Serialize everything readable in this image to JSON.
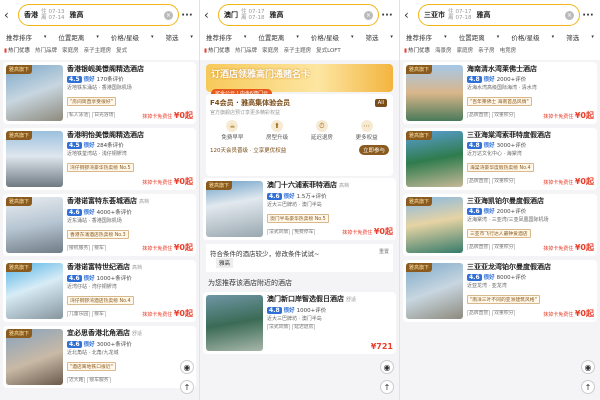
{
  "screens": [
    {
      "city": "香港",
      "checkin": "07-13",
      "checkout": "07-14",
      "checkin_label": "住",
      "checkout_label": "离",
      "keyword": "雅高",
      "filters": [
        "推荐排序",
        "位置距离",
        "价格/星级",
        "筛选"
      ],
      "chips": [
        "热门优惠",
        "热门品牌",
        "家庭房",
        "亲子主题房",
        "复式"
      ],
      "hotels": [
        {
          "name": "香港银岘美憬阁精选酒店",
          "sub": "",
          "badge": "雅高旗下",
          "score": "4.5",
          "level": "很好",
          "reviews": "170条评价",
          "loc": "近地铁东涌站 · 香港国际机场",
          "tag": "\"房间简直享受很好\"",
          "extra": [
            "私人泳池",
            "日光浴场"
          ],
          "price": "¥0起",
          "price_note": "抹掉卡免费住"
        },
        {
          "name": "香港明怡美憬阁精选酒店",
          "sub": "",
          "badge": "雅高旗下",
          "score": "4.5",
          "level": "很好",
          "reviews": "284条评价",
          "loc": "近地铁荃湾站 · 浅仔铜锣湾",
          "tag": "湾仔铜锣湾豪华热卖榜 No.5",
          "extra": [],
          "price": "¥0起",
          "price_note": "抹掉卡免费住"
        },
        {
          "name": "香港诺富特东荟城酒店",
          "sub": "高档",
          "badge": "雅高旗下",
          "score": "4.6",
          "level": "很好",
          "reviews": "4000+条评价",
          "loc": "近东涌站 · 香港国际机场",
          "tag": "香港东涌酒店热卖榜 No.3",
          "extra": [
            "接机服务",
            "接车"
          ],
          "price": "¥0起",
          "price_note": "抹掉卡免费住"
        },
        {
          "name": "香港诺富特世纪酒店",
          "sub": "高档",
          "badge": "雅高旗下",
          "score": "4.6",
          "level": "很好",
          "reviews": "1000+条评价",
          "loc": "近湾仔站 · 湾仔铜锣湾",
          "tag": "湾仔铜锣湾酒店热卖榜 No.4",
          "extra": [
            "儿童乐园",
            "接车"
          ],
          "price": "¥0起",
          "price_note": "抹掉卡免费住"
        },
        {
          "name": "宜必思香港北角酒店",
          "sub": "舒适",
          "badge": "雅高旗下",
          "score": "4.6",
          "level": "很好",
          "reviews": "3000+条评价",
          "loc": "近北角站 · 北角/九龙城",
          "tag": "\"酒店离地铁口很近\"",
          "extra": [
            "近大路",
            "接车服务"
          ],
          "price": "",
          "price_note": ""
        }
      ]
    },
    {
      "city": "澳门",
      "checkin": "07-17",
      "checkout": "07-18",
      "checkin_label": "住",
      "checkout_label": "离",
      "keyword": "雅高",
      "filters": [
        "推荐排序",
        "位置距离",
        "价格/星级",
        "筛选"
      ],
      "chips": [
        "热门优惠",
        "热门品牌",
        "家庭房",
        "亲子主题房",
        "复式LOFT"
      ],
      "promo_title": "订酒店领雅高门通赌名卡",
      "promo_sub": "可全公元 | 内含6澳门元",
      "f4": {
        "title": "F4会员 · 雅高集体验会员",
        "sub": "官方旗舰店预订享更多精彩权益",
        "all": "All",
        "items": [
          "免费早早",
          "房型升级",
          "延迟退房",
          "更多权益"
        ],
        "bottom": "120天会员晋级 · 立享更优权益",
        "btn": "立即参与"
      },
      "hotels": [
        {
          "name": "澳门十六浦索菲特酒店",
          "sub": "高档",
          "badge": "雅高旗下",
          "score": "4.6",
          "level": "很好",
          "reviews": "1.5万+评价",
          "loc": "近大三巴牌坊 · 澳门半岛",
          "tag": "澳门半岛豪华热卖榜 No.5",
          "extra": [
            "法式风情",
            "免费停车"
          ],
          "price": "¥0起",
          "price_note": "抹掉卡免费住"
        }
      ],
      "nomatch": "符合条件的酒店较少，修改条件试试~",
      "nomatch_kw": "雅高",
      "nomatch_reset": "重置",
      "section": "为您推荐该酒店附近的酒店",
      "nearby": [
        {
          "name": "澳门新口岸智选假日酒店",
          "sub": "舒适",
          "badge": "",
          "score": "4.8",
          "level": "很好",
          "reviews": "1000+评价",
          "loc": "近大三巴牌坊 · 澳门半岛",
          "tag": "",
          "extra": [
            "法式风情",
            "延迟退房"
          ],
          "price": "¥721",
          "price_note": ""
        }
      ]
    },
    {
      "city": "三亚市",
      "checkin": "07-17",
      "checkout": "07-18",
      "checkin_label": "住",
      "checkout_label": "离",
      "keyword": "雅高",
      "filters": [
        "推荐排序",
        "位置距离",
        "价格/星级",
        "筛选"
      ],
      "chips": [
        "热门优惠",
        "海景房",
        "家庭房",
        "亲子房",
        "电竞房"
      ],
      "hotels": [
        {
          "name": "海南清水湾莱佛士酒店",
          "sub": "",
          "badge": "雅高旗下",
          "score": "4.8",
          "level": "很好",
          "reviews": "2000+评价",
          "loc": "近海水湾高级国际海湾 · 清水湾",
          "tag": "\"百年莱佛士 海南首品风情\"",
          "extra": [
            "品牌直营",
            "双重积分"
          ],
          "price": "¥0起",
          "price_note": "抹掉卡免费住"
        },
        {
          "name": "三亚海棠湾索菲特度假酒店",
          "sub": "",
          "badge": "雅高旗下",
          "score": "4.8",
          "level": "很好",
          "reviews": "3000+评价",
          "loc": "近万达文化中心 · 海棠湾",
          "tag": "海棠湾豪华度假热卖榜 No.4",
          "extra": [
            "品牌直营",
            "双重积分"
          ],
          "price": "¥0起",
          "price_note": "抹掉卡免费住"
        },
        {
          "name": "三亚海凯铂尔曼度假酒店",
          "sub": "",
          "badge": "雅高旗下",
          "score": "4.6",
          "level": "很好",
          "reviews": "2000+评价",
          "loc": "近海棠湾 · 三亚湾/三亚凤凰国际机场",
          "tag": "三亚市飞行达人最钟爱酒店",
          "extra": [
            "品牌直营",
            "双重积分"
          ],
          "price": "¥0起",
          "price_note": "抹掉卡免费住"
        },
        {
          "name": "三亚亚龙湾铂尔曼度假酒店",
          "sub": "",
          "badge": "雅高旗下",
          "score": "4.6",
          "level": "很好",
          "reviews": "8000+评价",
          "loc": "近亚龙湾 · 亚龙湾",
          "tag": "\"南洋三叶不同的亚洲建筑风格\"",
          "extra": [
            "品牌直营",
            "双重积分"
          ],
          "price": "¥0起",
          "price_note": "抹掉卡免费住"
        }
      ]
    }
  ]
}
